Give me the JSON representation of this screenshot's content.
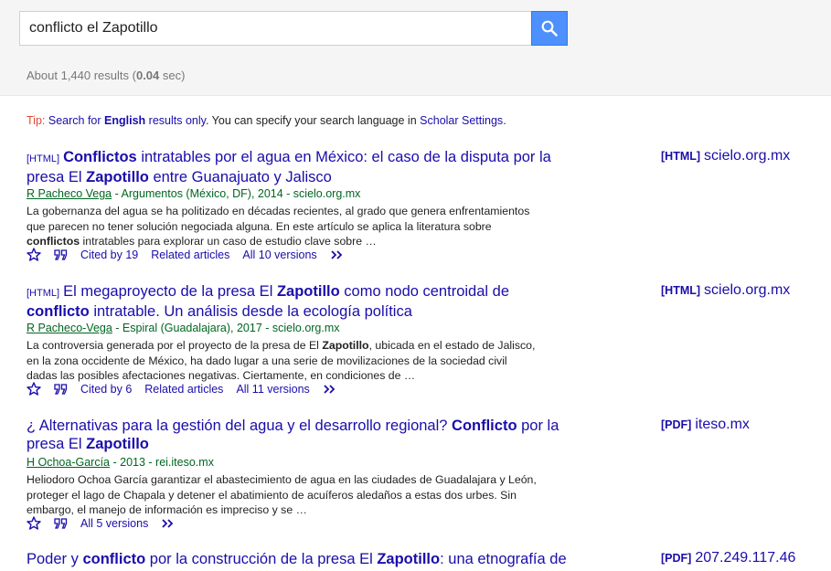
{
  "search": {
    "query": "conflicto el Zapotillo"
  },
  "stats": {
    "prefix": "About 1,440 results (",
    "time": "0.04",
    "suffix": " sec)"
  },
  "tip": {
    "label": "Tip:",
    "link1": "Search for",
    "link1_bold": "English",
    "link1_end": "results only",
    "middle": ". You can specify your search language in",
    "settings_link": "Scholar Settings",
    "end": "."
  },
  "results": [
    {
      "tag": "[HTML]",
      "title_html": "<b>Conflictos</b> intratables por el agua en México: el caso de la disputa por la presa El <b>Zapotillo</b> entre Guanajuato y Jalisco",
      "author": "R Pacheco Vega",
      "source": " - Argumentos (México, DF), 2014 - scielo.org.mx",
      "snippet_html": "La gobernanza del agua se ha politizado en décadas recientes, al grado que genera enfrentamientos que parecen no tener solución negociada alguna. En este artículo se aplica la literatura sobre <b>conflictos</b> intratables para explorar un caso de estudio clave sobre …",
      "cited": "Cited by 19",
      "related": "Related articles",
      "versions": "All 10 versions",
      "side_tag": "[HTML]",
      "side_domain": "scielo.org.mx"
    },
    {
      "tag": "[HTML]",
      "title_html": "El megaproyecto de la presa El <b>Zapotillo</b> como nodo centroidal de <b>conflicto</b> intratable. Un análisis desde la ecología política",
      "author": "R Pacheco-Vega",
      "source": " - Espiral (Guadalajara), 2017 - scielo.org.mx",
      "snippet_html": "La controversia generada por el proyecto de la presa de El <b>Zapotillo</b>, ubicada en el estado de Jalisco, en la zona occidente de México, ha dado lugar a una serie de movilizaciones de la sociedad civil dadas las posibles afectaciones negativas. Ciertamente, en condiciones de …",
      "cited": "Cited by 6",
      "related": "Related articles",
      "versions": "All 11 versions",
      "side_tag": "[HTML]",
      "side_domain": "scielo.org.mx"
    },
    {
      "tag": "",
      "title_html": "¿ Alternativas para la gestión del agua y el desarrollo regional? <b>Conflicto</b> por la presa El <b>Zapotillo</b>",
      "author": "H Ochoa-García",
      "source": " - 2013 - rei.iteso.mx",
      "snippet_html": "Heliodoro Ochoa García garantizar el abastecimiento de agua en las ciudades de Guadalajara y León, proteger el lago de Chapala y detener el abatimiento de acuíferos aledaños a estas dos urbes. Sin embargo, el manejo de información es impreciso y se …",
      "cited": "",
      "related": "",
      "versions": "All 5 versions",
      "side_tag": "[PDF]",
      "side_domain": "iteso.mx"
    },
    {
      "tag": "",
      "title_html": "Poder y <b>conflicto</b> por la construcción de la presa El <b>Zapotillo</b>: una etnografía de",
      "side_tag": "[PDF]",
      "side_domain": "207.249.117.46"
    }
  ]
}
